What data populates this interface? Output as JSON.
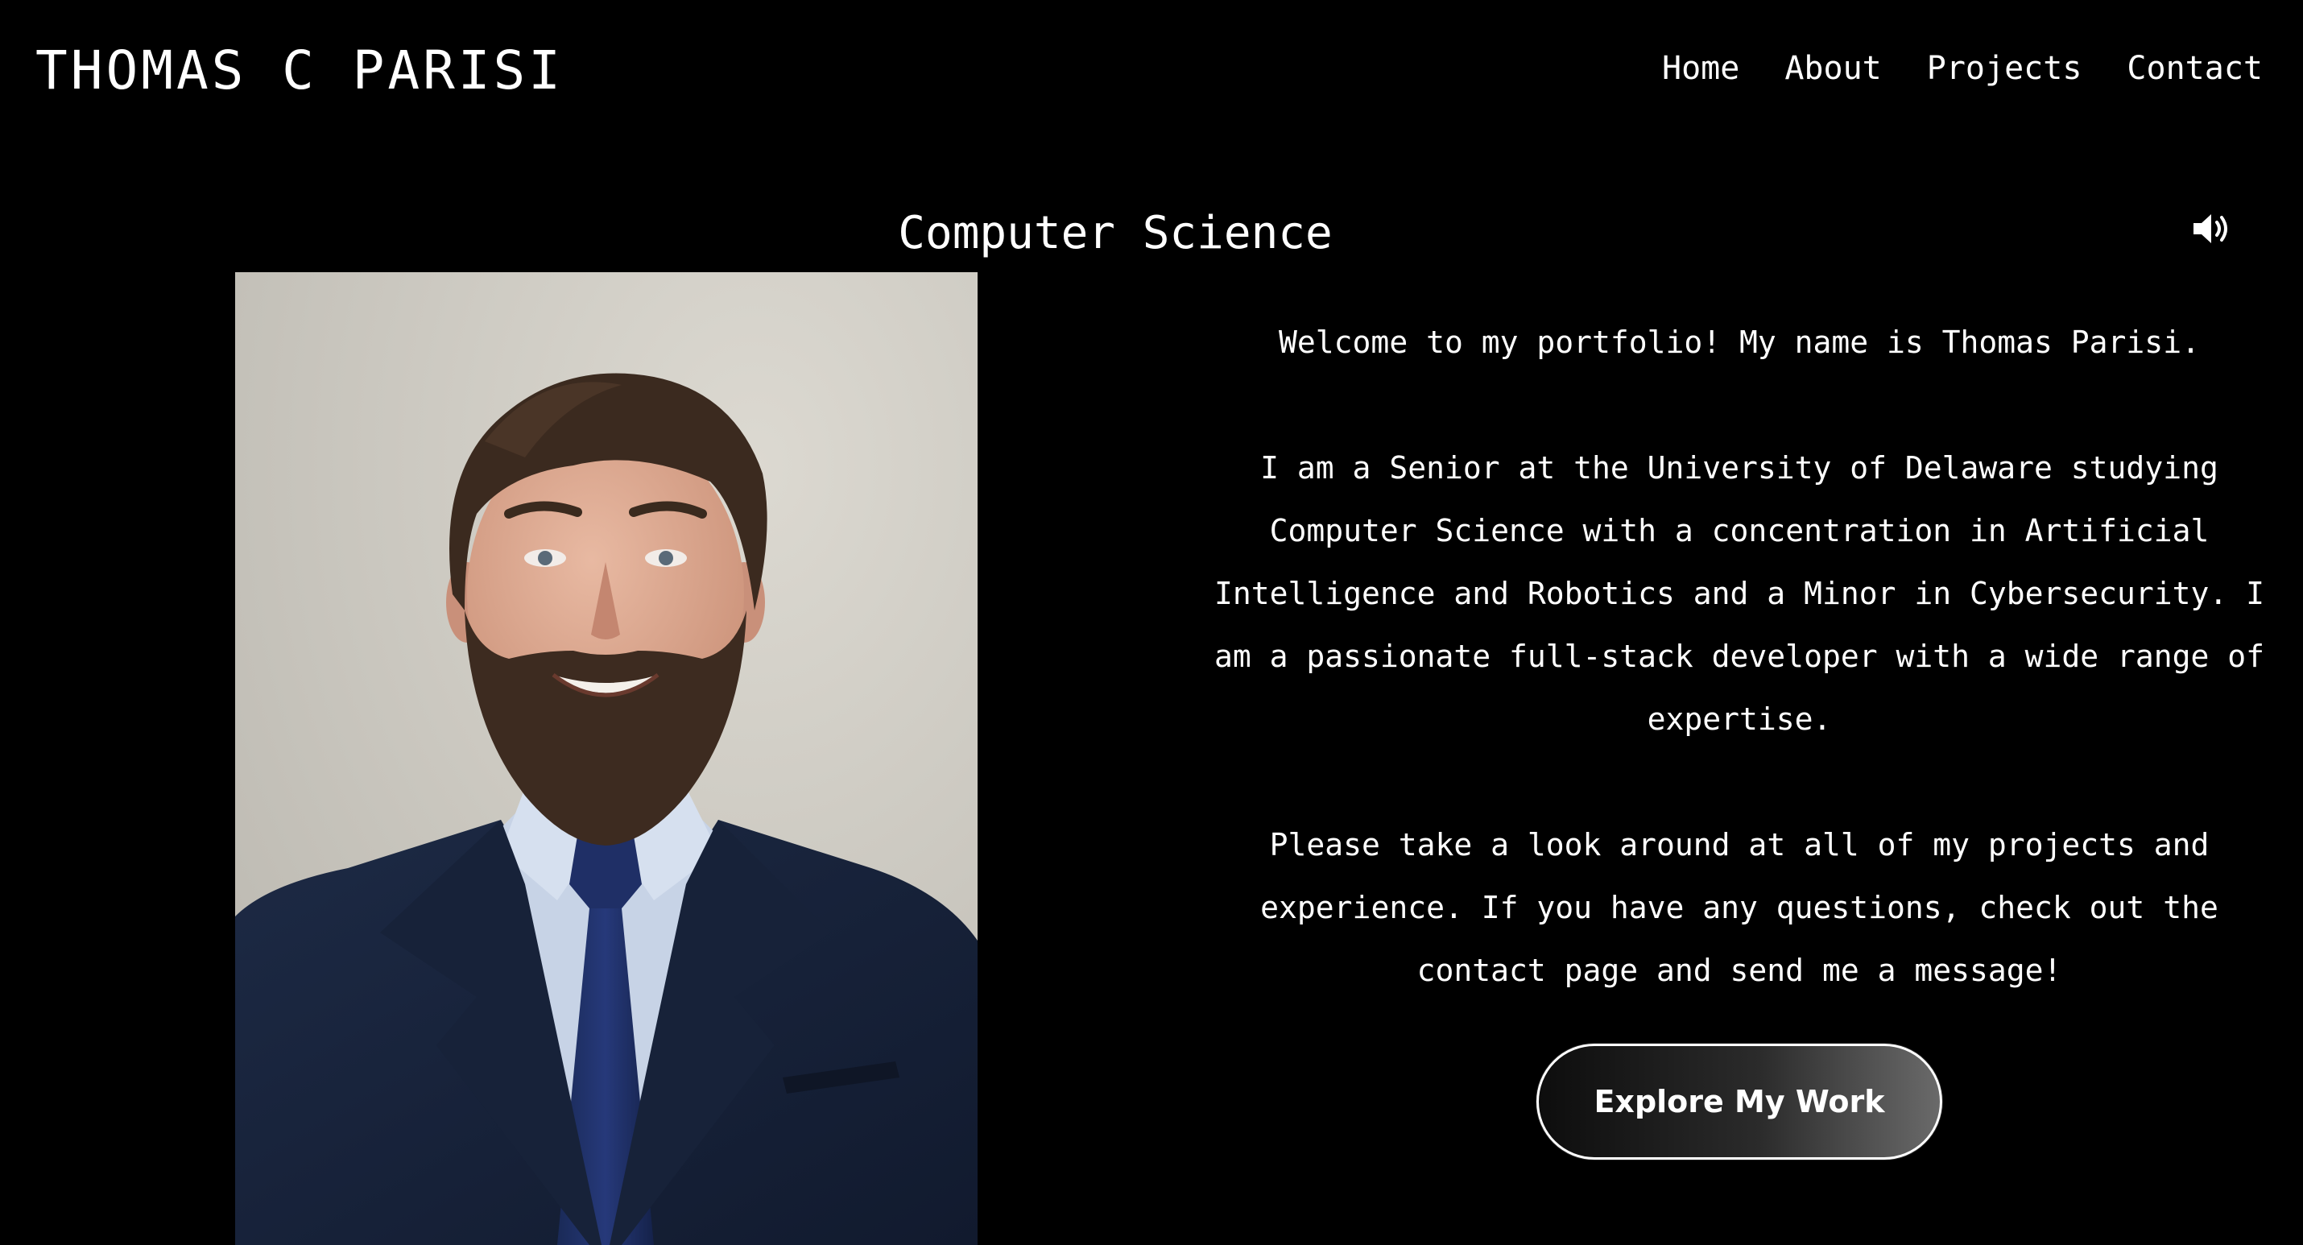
{
  "header": {
    "brand": "THOMAS C PARISI",
    "nav": [
      "Home",
      "About",
      "Projects",
      "Contact"
    ]
  },
  "hero": {
    "title": "Computer Science",
    "sound_icon": "speaker-volume-icon",
    "portrait_icon": "portrait-photo",
    "paragraphs": [
      "Welcome to my portfolio! My name is Thomas Parisi.",
      "I am a Senior at the University of Delaware studying Computer Science with a concentration in Artificial Intelligence and Robotics and a Minor in Cybersecurity. I am a passionate full-stack developer with a wide range of expertise.",
      "Please take a look around at all of my projects and experience. If you have any questions, check out the contact page and send me a message!"
    ],
    "cta_label": "Explore My Work"
  },
  "colors": {
    "background": "#000000",
    "text": "#ffffff",
    "button_gradient_start": "#0d0d0d",
    "button_gradient_end": "#6a6a6a"
  }
}
